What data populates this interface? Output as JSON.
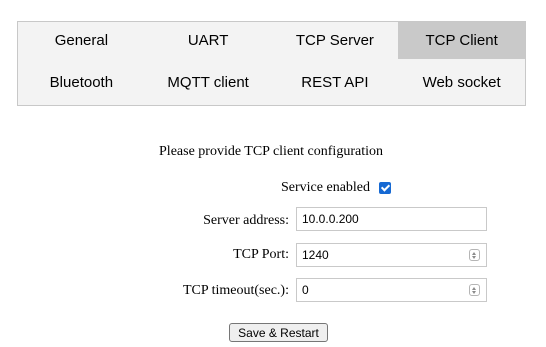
{
  "tabs": {
    "row1": [
      "General",
      "UART",
      "TCP Server",
      "TCP Client"
    ],
    "row2": [
      "Bluetooth",
      "MQTT client",
      "REST API",
      "Web socket"
    ],
    "active": "TCP Client"
  },
  "form": {
    "prompt": "Please provide TCP client configuration",
    "service_enabled_label": "Service enabled",
    "service_enabled": true,
    "server_address_label": "Server address:",
    "server_address_value": "10.0.0.200",
    "tcp_port_label": "TCP Port:",
    "tcp_port_value": "1240",
    "tcp_timeout_label": "TCP timeout(sec.):",
    "tcp_timeout_value": "0",
    "save_label": "Save & Restart"
  },
  "colors": {
    "tab_bar_bg": "#f3f3f3",
    "active_tab_bg": "#c9c9c9",
    "checkbox_accent": "#1669d3"
  }
}
